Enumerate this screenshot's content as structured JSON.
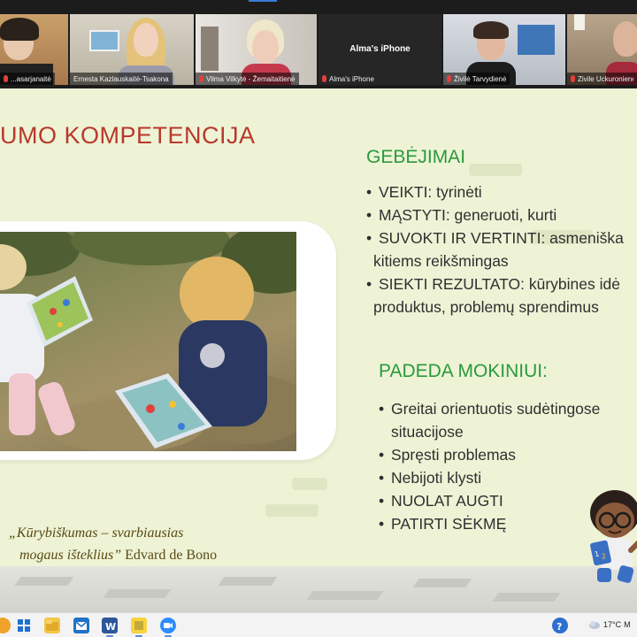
{
  "colors": {
    "slide_bg": "#eef3d6",
    "title_red": "#b8392b",
    "heading_green": "#2a9a3c",
    "quote_brown": "#5a4a12",
    "active_speaker": "#c9d34a",
    "mic_muted": "#e0413c"
  },
  "participants": [
    {
      "name": "...asarjanaitė",
      "muted": true,
      "active": false
    },
    {
      "name": "Ernesta Kazlauskaitė-Tsakona",
      "muted": false,
      "active": true
    },
    {
      "name": "Vilma Vilkytė - Žemaitaitienė",
      "muted": true,
      "active": false
    },
    {
      "name": "Alma's iPhone",
      "center_label": "Alma's iPhone",
      "muted": true,
      "active": false
    },
    {
      "name": "Živilė Tarvydienė",
      "muted": true,
      "active": false
    },
    {
      "name": "Zivile Uckuronienė",
      "muted": true,
      "active": false
    }
  ],
  "slide": {
    "title": "UMO KOMPETENCIJA",
    "abilities_heading": "GEBĖJIMAI",
    "abilities": [
      {
        "bullet": "•",
        "text": "VEIKTI: tyrinėti"
      },
      {
        "bullet": "•",
        "text": "MĄSTYTI: generuoti, kurti"
      },
      {
        "bullet": "•",
        "text": "SUVOKTI IR VERTINTI: asmeniška",
        "cont": "kitiems reikšmingas"
      },
      {
        "bullet": "•",
        "text": "SIEKTI REZULTATO: kūrybines idė",
        "cont": "produktus, problemų sprendimus"
      }
    ],
    "helps_heading": "PADEDA MOKINIUI:",
    "helps": [
      {
        "bullet": "•",
        "text": "Greitai orientuotis sudėtingose",
        "cont": "situacijose"
      },
      {
        "bullet": "•",
        "text": "Spręsti problemas"
      },
      {
        "bullet": "•",
        "text": "Nebijoti klysti"
      },
      {
        "bullet": "•",
        "text": "NUOLAT AUGTI"
      },
      {
        "bullet": "•",
        "text": "PATIRTI SĖKMĘ"
      }
    ],
    "quote_line1": "„Kūrybiškumas – svarbiausias",
    "quote_line2": "mogaus išteklius”",
    "quote_author": "Edvard de Bono"
  },
  "taskbar": {
    "icons": [
      "windows-icon",
      "search-icon",
      "file-explorer-icon",
      "mail-icon",
      "word-icon",
      "sticky-notes-icon",
      "zoom-icon"
    ],
    "tray_icons": [
      "help-icon",
      "weather-icon"
    ],
    "weather_temp": "17°C",
    "weather_trail": "M"
  }
}
